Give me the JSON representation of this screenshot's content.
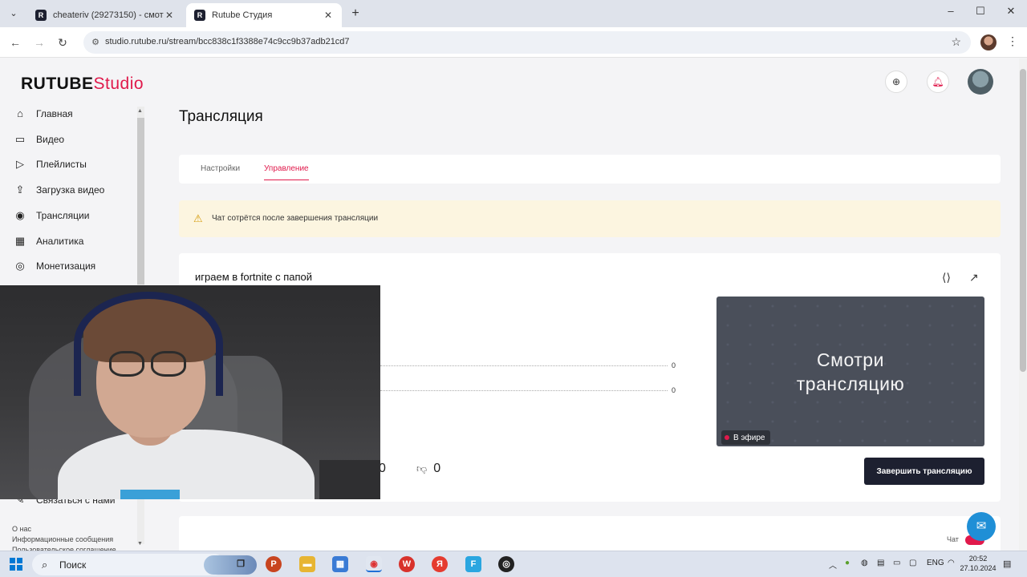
{
  "browser": {
    "tabs": [
      {
        "title": "cheateriv (29273150) - смотре...",
        "active": false
      },
      {
        "title": "Rutube Студия",
        "active": true
      }
    ],
    "tab_favicon": "R",
    "url": "studio.rutube.ru/stream/bcc838c1f3388e74c9cc9b37adb21cd7"
  },
  "logo": {
    "main": "RUTUBE",
    "sub": "Studio"
  },
  "sidebar": {
    "items": [
      {
        "label": "Главная",
        "icon": "home-icon"
      },
      {
        "label": "Видео",
        "icon": "video-icon"
      },
      {
        "label": "Плейлисты",
        "icon": "playlist-icon"
      },
      {
        "label": "Загрузка видео",
        "icon": "upload-icon"
      },
      {
        "label": "Трансляции",
        "icon": "broadcast-icon"
      },
      {
        "label": "Аналитика",
        "icon": "analytics-icon"
      },
      {
        "label": "Монетизация",
        "icon": "monetization-icon"
      }
    ],
    "contact": "Связаться с нами",
    "footer": [
      "О нас",
      "Информационные сообщения",
      "Пользовательское соглашение"
    ]
  },
  "page": {
    "title": "Трансляция",
    "tabs": [
      {
        "label": "Настройки",
        "active": false
      },
      {
        "label": "Управление",
        "active": true
      }
    ],
    "warning": "Чат сотрётся после завершения трансляции"
  },
  "stream": {
    "title": "играем в fortnite с папой",
    "stat1": "0",
    "stat2": "0",
    "likes": "0",
    "dislikes": "0",
    "preview_text_line1": "Смотри",
    "preview_text_line2": "трансляцию",
    "live_badge": "В эфире",
    "end_button": "Завершить трансляцию",
    "chat_label": "Чат"
  },
  "taskbar": {
    "search": "Поиск",
    "lang": "ENG",
    "time": "20:52",
    "date": "27.10.2024"
  },
  "colors": {
    "accent": "#e0194b",
    "dark_button": "#1d2030",
    "warning_bg": "#fcf5e0"
  }
}
